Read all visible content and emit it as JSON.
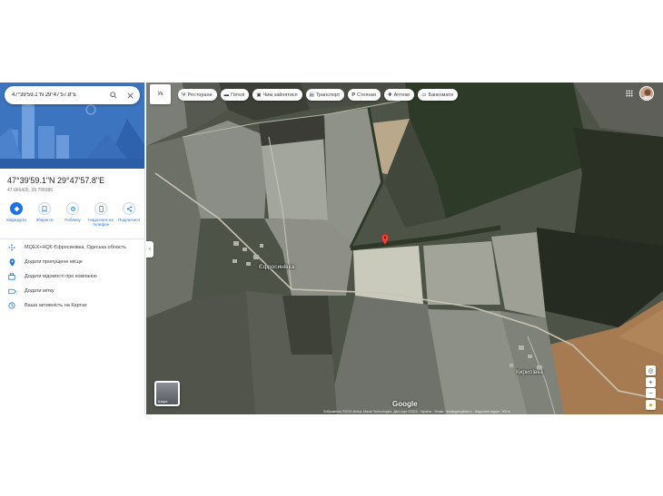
{
  "search": {
    "value": "47°39'59.1\"N 29°47'57.8\"E"
  },
  "place": {
    "title": "47°39'59.1\"N 29°47'57.8\"E",
    "decimal": "47.666426, 29.799386"
  },
  "actions": [
    {
      "icon": "directions-icon",
      "label": "Маршрути"
    },
    {
      "icon": "bookmark-icon",
      "label": "Зберегти"
    },
    {
      "icon": "nearby-icon",
      "label": "Поблизу"
    },
    {
      "icon": "phone-icon",
      "label": "Надіслати на телефон"
    },
    {
      "icon": "share-icon",
      "label": "Поділитися"
    }
  ],
  "info": [
    {
      "icon": "plus-code-icon",
      "text": "MQEX+HQ6 Єфросинівка, Одеська область"
    },
    {
      "icon": "location-pin-icon",
      "text": "Додати пропущене місце"
    },
    {
      "icon": "business-icon",
      "text": "Додати відомості про компанію"
    },
    {
      "icon": "label-icon",
      "text": "Додати мітку"
    },
    {
      "icon": "history-icon",
      "text": "Ваша активність на Картах"
    }
  ],
  "map": {
    "layer_toggle": "Ук",
    "chips": [
      {
        "icon": "restaurant-icon",
        "label": "Ресторани"
      },
      {
        "icon": "hotel-icon",
        "label": "Готелі"
      },
      {
        "icon": "camera-icon",
        "label": "Чим зайнятися"
      },
      {
        "icon": "transit-icon",
        "label": "Транспорт"
      },
      {
        "icon": "parking-icon",
        "label": "Стоянки"
      },
      {
        "icon": "pharmacy-icon",
        "label": "Аптеки"
      },
      {
        "icon": "atm-icon",
        "label": "Банкомати"
      }
    ],
    "labels": {
      "village1": "Єфросинівка",
      "village2": "Кирилівка"
    },
    "thumbnail_label": "Шари",
    "google": "Google",
    "attribution": "Зображення ©2023 Airbus, Maxar Technologies, Дані карт ©2023 · Україна · Умови · Конфіденційність · Надіслати відгук · 200 м"
  },
  "colors": {
    "accent": "#1a73e8",
    "pin": "#ea4335"
  }
}
